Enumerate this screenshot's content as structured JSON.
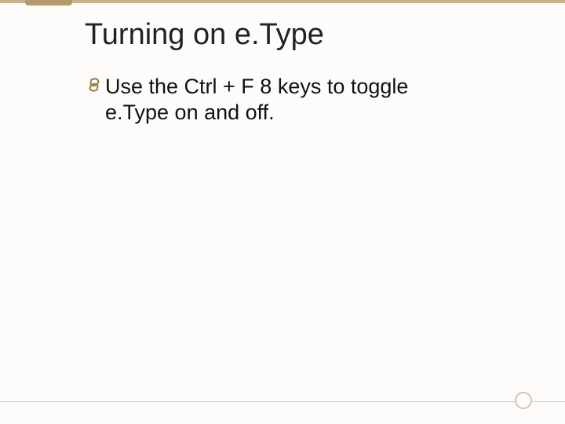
{
  "title": "Turning on e.Type",
  "body": {
    "items": [
      {
        "text": "Use the Ctrl + F 8 keys to toggle e.Type on and off."
      }
    ]
  },
  "theme": {
    "accent": "#b59a6e",
    "accent_light": "#cbb28b",
    "rule": "#d9ccb4",
    "bg": "#fdfcfa"
  }
}
